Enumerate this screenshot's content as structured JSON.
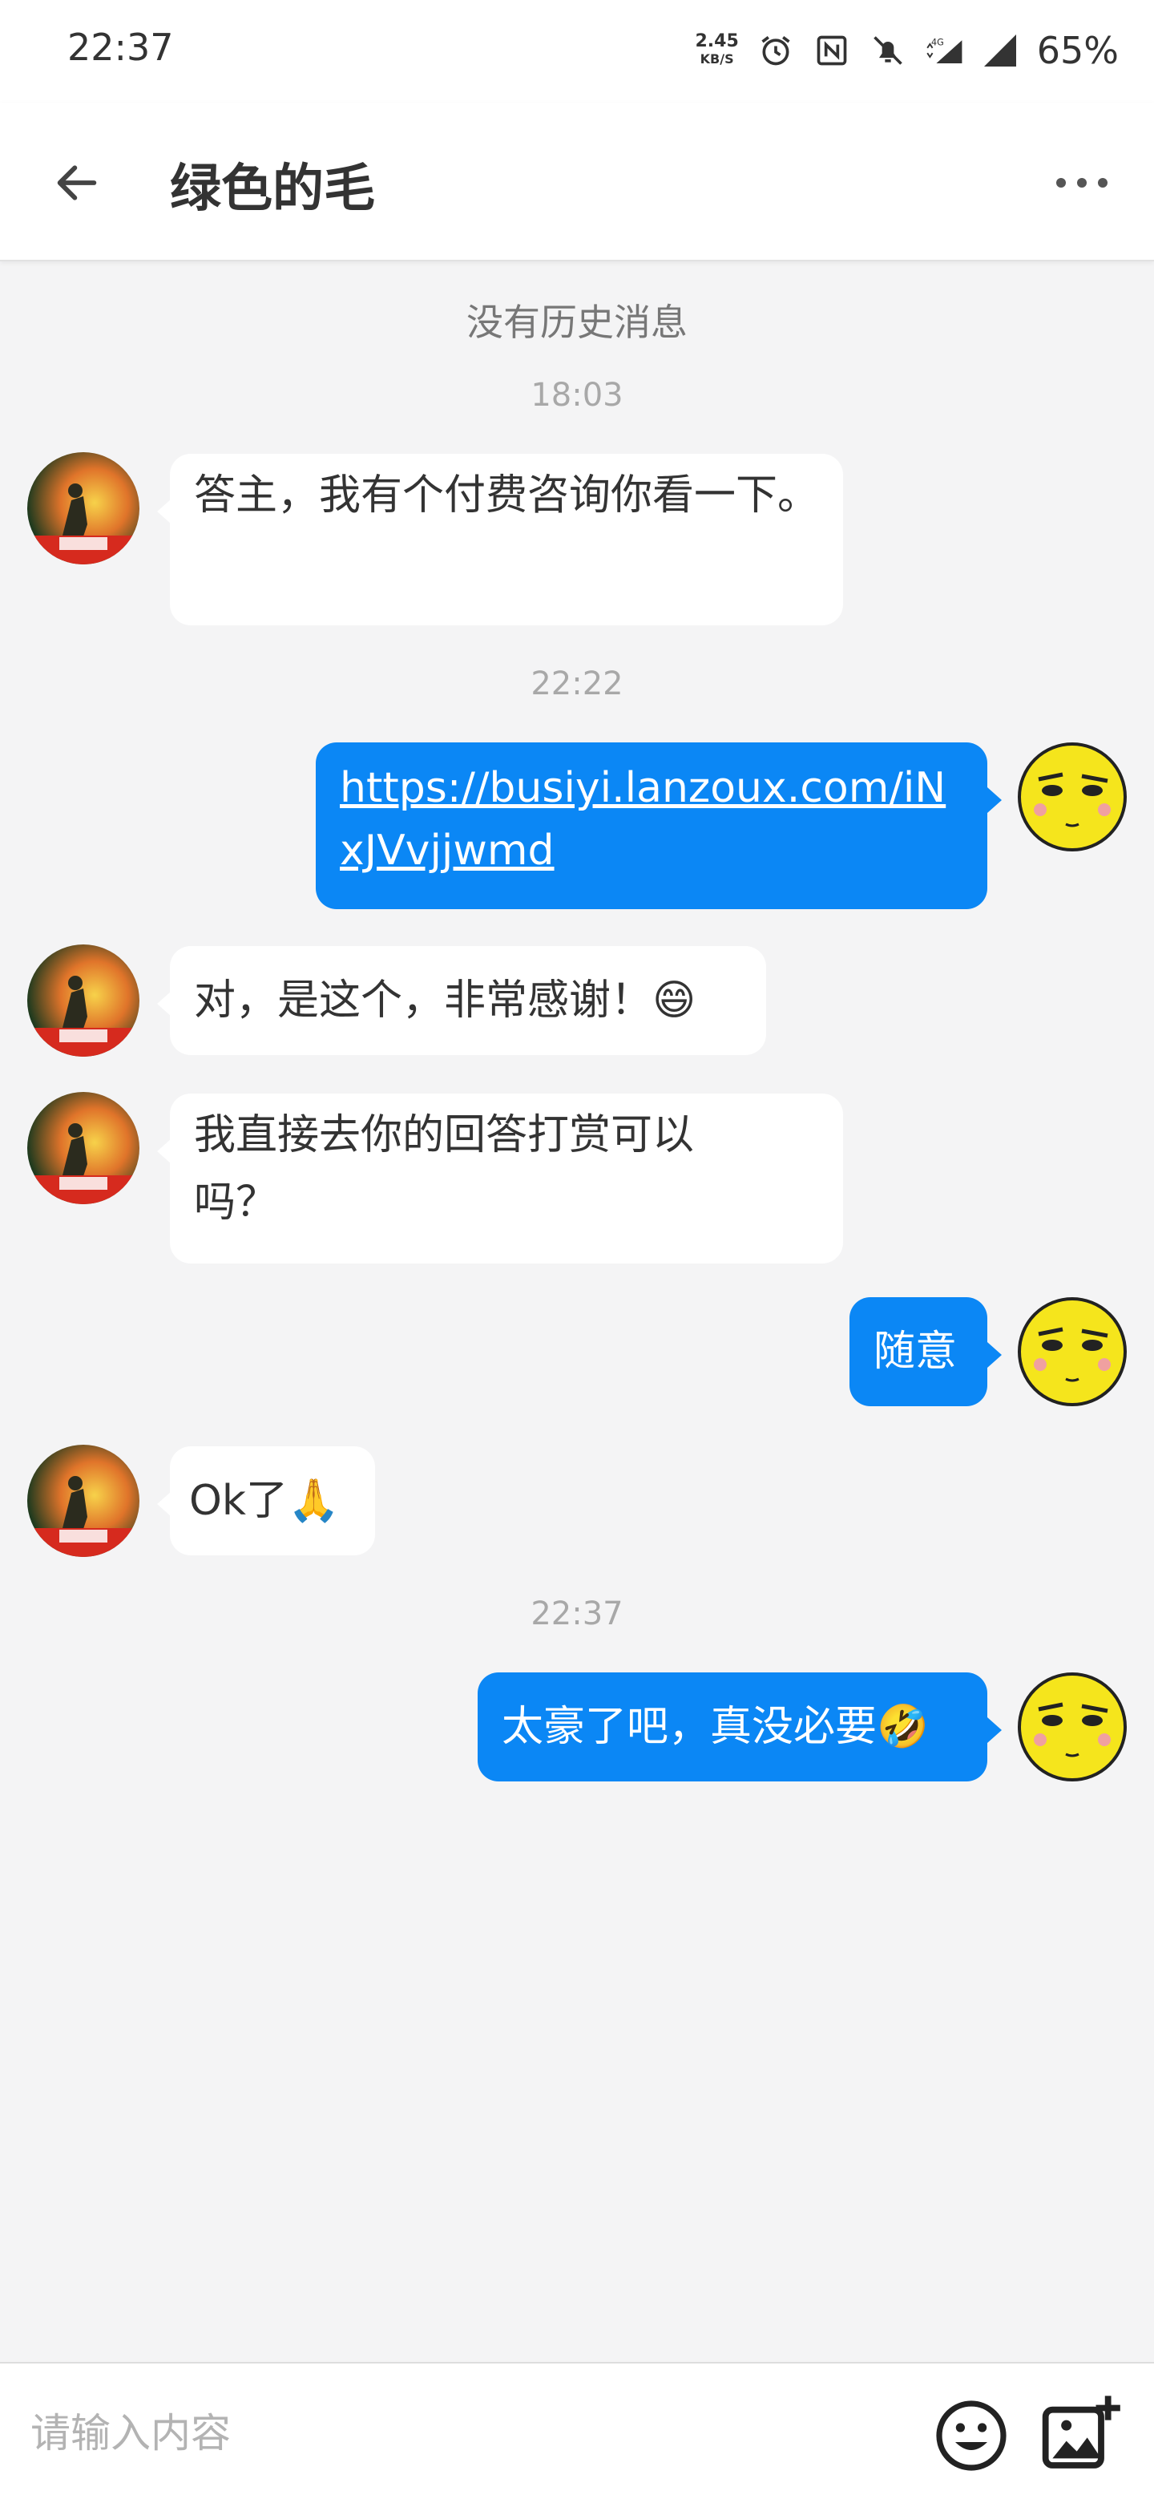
{
  "status_bar": {
    "time": "22:37",
    "net_speed": "2.45",
    "net_unit": "KB/S",
    "network": "4G",
    "battery": "65%"
  },
  "header": {
    "title": "绿色的毛",
    "back_icon": "arrow-left-icon",
    "more_icon": "more-horizontal-icon"
  },
  "chat": {
    "no_history": "没有历史消息",
    "timestamps": [
      "18:03",
      "22:22",
      "22:37"
    ],
    "messages": [
      {
        "from": "other",
        "text": "答主，我有个付费咨询你看一下。"
      },
      {
        "from": "me",
        "text": "https://busiyi.lanzoux.com/iNxJVvjjwmd",
        "is_link": true
      },
      {
        "from": "other",
        "text": "对，是这个，非常感谢！😄"
      },
      {
        "from": "other",
        "text": "我直接去你的回答打赏可以吗？"
      },
      {
        "from": "me",
        "text": "随意"
      },
      {
        "from": "other",
        "text": "Ok了🙏"
      },
      {
        "from": "me",
        "text": "太豪了吧，真没必要🤣"
      }
    ]
  },
  "composer": {
    "placeholder": "请输入内容",
    "emoji_icon": "smiley-icon",
    "image_icon": "add-image-icon"
  },
  "colors": {
    "outgoing_bubble": "#0b87f5",
    "incoming_bubble": "#ffffff",
    "background": "#f4f4f5"
  }
}
